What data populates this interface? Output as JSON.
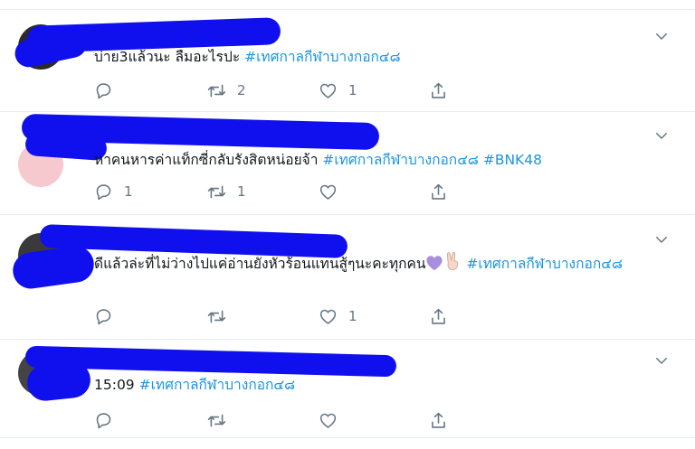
{
  "tweets": [
    {
      "text": "บ่าย3แล้วนะ ลืมอะไรปะ",
      "hashtags": [
        "#เทศกาลกีฬาบางกอก๔๘"
      ],
      "reply_count": "",
      "retweet_count": "2",
      "like_count": "1"
    },
    {
      "text": "หาคนหารค่าแท็กซี่กลับรังสิตหน่อยจ้า",
      "hashtags": [
        "#เทศกาลกีฬาบางกอก๔๘",
        "#BNK48"
      ],
      "reply_count": "1",
      "retweet_count": "1",
      "like_count": ""
    },
    {
      "text": "ดีแล้วล่ะที่ไม่ว่างไปแค่อ่านยังหัวร้อนแทนสู้ๆนะคะทุกคน",
      "hashtags": [
        "#เทศกาลกีฬาบางกอก๔๘"
      ],
      "reply_count": "",
      "retweet_count": "",
      "like_count": "1"
    },
    {
      "text": "15:09",
      "hashtags": [
        "#เทศกาลกีฬาบางกอก๔๘"
      ],
      "reply_count": "",
      "retweet_count": "",
      "like_count": ""
    }
  ],
  "icons": {
    "reply": "reply-icon",
    "retweet": "retweet-icon",
    "like": "heart-icon",
    "share": "share-icon",
    "caret": "chevron-down-icon"
  },
  "colors": {
    "hashtag": "#1b95e0",
    "icon": "#657786",
    "redaction": "#1010ee",
    "divider": "#e6ecf0"
  }
}
